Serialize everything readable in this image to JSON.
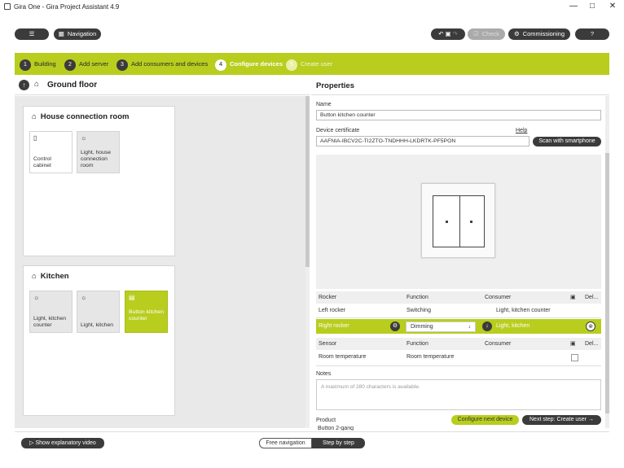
{
  "window": {
    "title": "Gira One - Gira Project Assistant 4.9",
    "minimize": "—",
    "maximize": "□",
    "close": "✕"
  },
  "header": {
    "menu_label": "☰",
    "navigation_label": "Navigation",
    "check_label": "Check",
    "commissioning_label": "Commissioning",
    "help_label": "?"
  },
  "steps": [
    {
      "num": "1",
      "label": "Building",
      "state": "done"
    },
    {
      "num": "2",
      "label": "Add server",
      "state": "done"
    },
    {
      "num": "3",
      "label": "Add consumers and devices",
      "state": "done"
    },
    {
      "num": "4",
      "label": "Configure devices",
      "state": "active"
    },
    {
      "num": "5",
      "label": "Create user",
      "state": "future"
    }
  ],
  "left": {
    "title": "Ground floor",
    "rooms": [
      {
        "name": "House connection room",
        "tiles": [
          {
            "label": "Control cabinet",
            "icon": "cabinet-icon"
          },
          {
            "label": "Light, house connection room",
            "icon": "light-icon"
          }
        ]
      },
      {
        "name": "Kitchen",
        "tiles": [
          {
            "label": "Light, kitchen counter",
            "icon": "light-icon"
          },
          {
            "label": "Light, kitchen",
            "icon": "light-icon"
          },
          {
            "label": "Button kitchen counter",
            "icon": "button-icon",
            "selected": true
          }
        ]
      }
    ]
  },
  "properties": {
    "title": "Properties",
    "name_label": "Name",
    "name_value": "Button kitchen counter",
    "cert_label": "Device certificate",
    "help_link": "Help",
    "cert_value": "AAFNIA-IBCV2C-TI2ZTO-TNDHHH-LKDRTK-PF5PON",
    "scan_label": "Scan with smartphone",
    "rocker_table": {
      "headers": [
        "Rocker",
        "Function",
        "Consumer",
        "Del..."
      ],
      "rows": [
        {
          "rocker": "Left rocker",
          "function": "Switching",
          "consumer": "Light, kitchen counter"
        },
        {
          "rocker": "Right rocker",
          "function": "Dimming",
          "consumer": "Light, kitchen"
        }
      ]
    },
    "sensor_table": {
      "headers": [
        "Sensor",
        "Function",
        "Consumer",
        "Del..."
      ],
      "rows": [
        {
          "sensor": "Room temperature",
          "function": "Room temperature",
          "consumer": ""
        }
      ]
    },
    "notes_label": "Notes",
    "notes_placeholder": "A maximum of 280 characters is available.",
    "product_label": "Product",
    "product_value": "Button 2-gang",
    "configure_next": "Configure next device",
    "next_step": "Next step: Create user →"
  },
  "footer": {
    "video_label": "Show explanatory video",
    "free_nav": "Free navigation",
    "step_by_step": "Step by step"
  },
  "colors": {
    "accent": "#b8cd1e",
    "dark": "#3b3b3b"
  }
}
